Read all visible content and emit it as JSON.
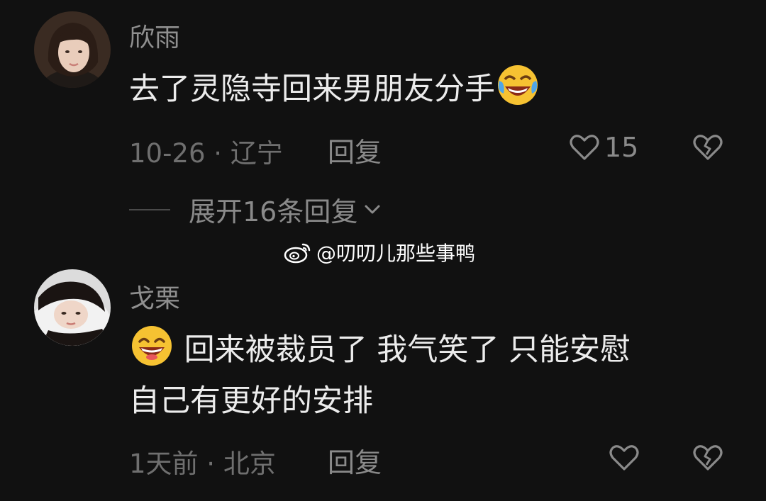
{
  "comments": [
    {
      "username": "欣雨",
      "text_before_emoji": "去了灵隐寺回来男朋友分手",
      "text_after_emoji": "",
      "emoji": "face-with-tears-of-joy",
      "date": "10-26",
      "location": "辽宁",
      "meta_sep": " · ",
      "reply_label": "回复",
      "like_count": "15"
    },
    {
      "username": "戈栗",
      "emoji": "grinning-squinting-face",
      "text_line1": "回来被裁员了 我气笑了 只能安慰",
      "text_line2": "自己有更好的安排",
      "date": "1天前",
      "location": "北京",
      "meta_sep": " · ",
      "reply_label": "回复",
      "like_count": ""
    }
  ],
  "expand_replies": {
    "label": "展开16条回复"
  },
  "watermark": {
    "handle": "@叨叨儿那些事鸭"
  },
  "colors": {
    "background": "#111111",
    "text": "#ececec",
    "muted": "#8a8a8a"
  },
  "icons": [
    "heart-icon",
    "dislike-broken-heart-icon",
    "chevron-down-icon",
    "weibo-logo"
  ]
}
